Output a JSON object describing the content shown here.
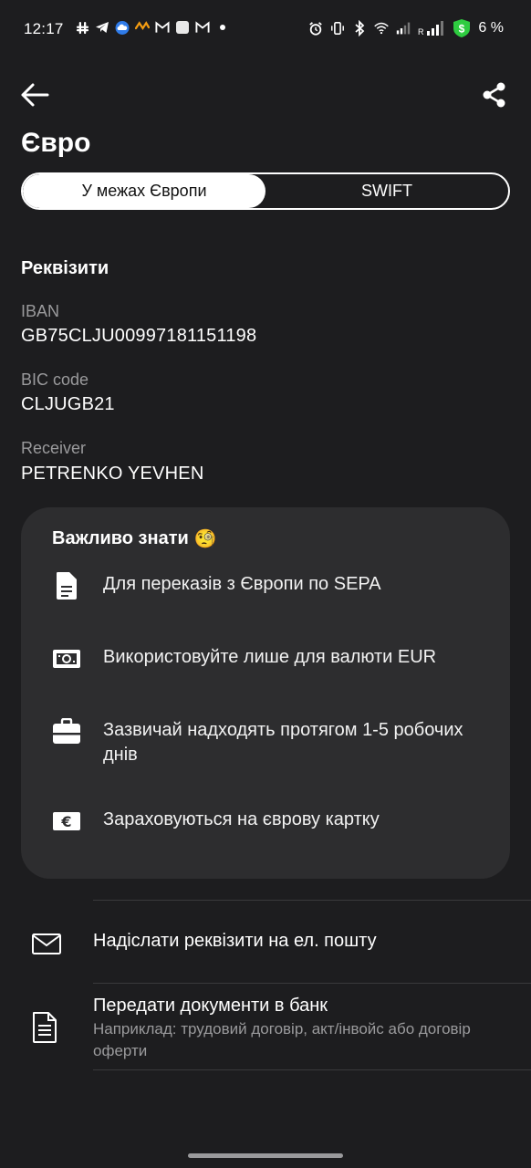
{
  "status_bar": {
    "time": "12:17",
    "battery": "6 %",
    "left_icons": [
      "slack-icon",
      "telegram-icon",
      "cloud-icon",
      "vpn-icon",
      "gmail-icon",
      "square-icon",
      "gmail-icon",
      "dot-icon"
    ],
    "right_icons": [
      "alarm-icon",
      "vibrate-icon",
      "bluetooth-icon",
      "wifi-icon",
      "signal-icon",
      "signal-roaming-icon",
      "shield-dollar-icon"
    ]
  },
  "header": {
    "title": "Євро"
  },
  "tabs": [
    {
      "label": "У межах Європи",
      "active": true
    },
    {
      "label": "SWIFT",
      "active": false
    }
  ],
  "requisites": {
    "heading": "Реквізити",
    "fields": [
      {
        "label": "IBAN",
        "value": "GB75CLJU00997181151198"
      },
      {
        "label": "BIC code",
        "value": "CLJUGB21"
      },
      {
        "label": "Receiver",
        "value": "PETRENKO YEVHEN"
      }
    ]
  },
  "info_card": {
    "title": "Важливо знати",
    "emoji": "🧐",
    "items": [
      {
        "icon": "document-icon",
        "text": "Для переказів з Європи по SEPA"
      },
      {
        "icon": "banknote-icon",
        "text": "Використовуйте лише для валюти EUR"
      },
      {
        "icon": "briefcase-icon",
        "text": "Зазвичай надходять протягом 1-5 робочих днів"
      },
      {
        "icon": "euro-card-icon",
        "text": "Зараховуються на єврову картку"
      }
    ]
  },
  "actions": [
    {
      "icon": "envelope-icon",
      "title": "Надіслати реквізити на ел. пошту",
      "subtitle": ""
    },
    {
      "icon": "document-lines-icon",
      "title": "Передати документи в банк",
      "subtitle": "Наприклад: трудовий договір, акт/інвойс або договір оферти"
    }
  ],
  "colors": {
    "background": "#1d1d1f",
    "card": "#2d2d2f",
    "secondary_text": "#9a9a9c",
    "battery_green": "#2ecc40"
  }
}
